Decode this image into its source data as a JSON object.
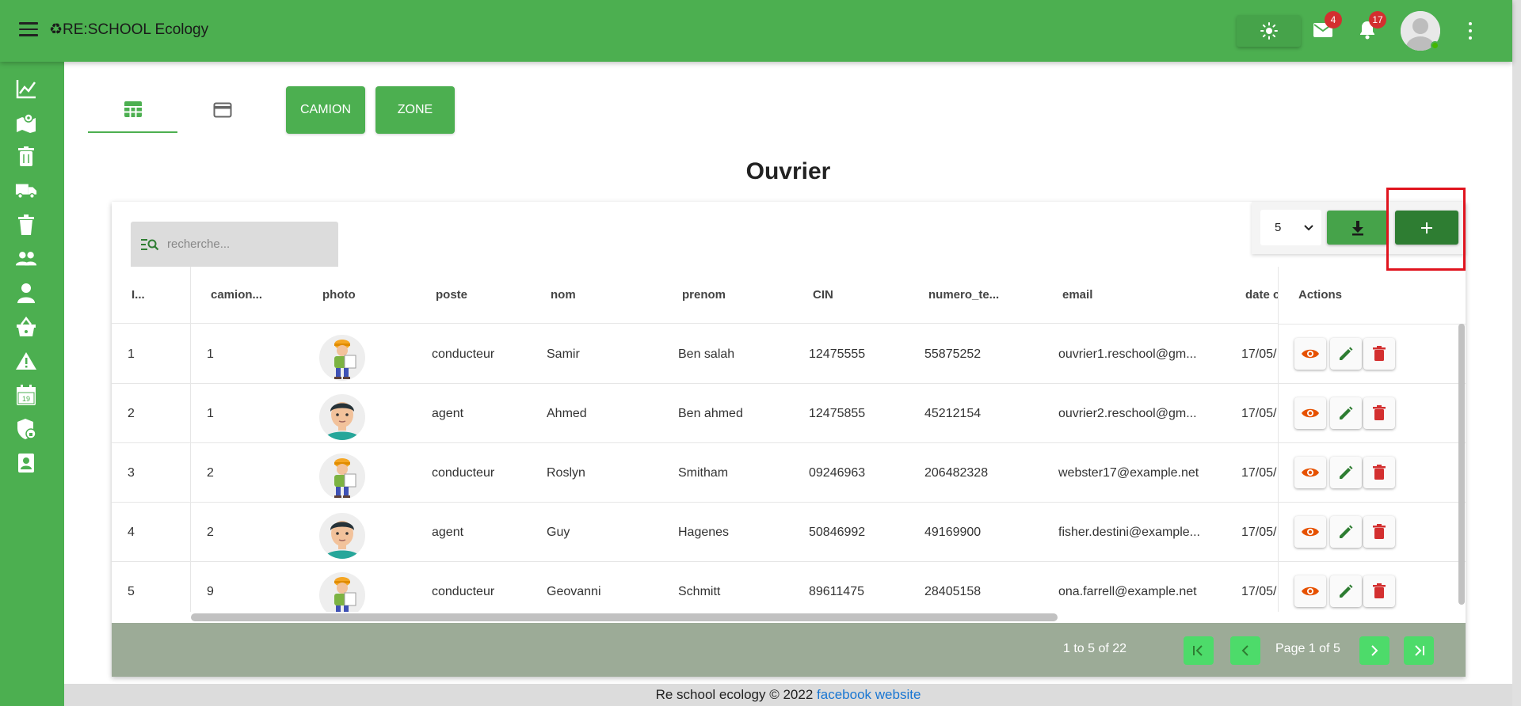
{
  "header": {
    "title": "♻RE:SCHOOL Ecology",
    "mail_count": "4",
    "notif_count": "17",
    "icons": [
      "menu-icon",
      "sun-icon",
      "mail-icon",
      "bell-icon",
      "avatar",
      "more-vert-icon"
    ]
  },
  "sidebar": {
    "icons": [
      "chart-icon",
      "map-icon",
      "trash-icon",
      "truck-icon",
      "bin-icon",
      "group-icon",
      "person-icon",
      "basket-icon",
      "warning-icon",
      "calendar-icon",
      "security-icon",
      "contact-icon"
    ],
    "calendar_day": "19"
  },
  "view_tabs": [
    "table-view-icon",
    "card-view-icon"
  ],
  "buttons": {
    "camion": "CAMION",
    "zone": "ZONE"
  },
  "page_title": "Ouvrier",
  "search": {
    "placeholder": "recherche..."
  },
  "per_page": "5",
  "table": {
    "headers": [
      "I...",
      "camion...",
      "photo",
      "poste",
      "nom",
      "prenom",
      "CIN",
      "numero_te...",
      "email",
      "date c",
      "Actions"
    ],
    "rows": [
      {
        "id": "1",
        "camion": "1",
        "photo": "worker",
        "poste": "conducteur",
        "nom": "Samir",
        "prenom": "Ben salah",
        "cin": "12475555",
        "tel": "55875252",
        "email": "ouvrier1.reschool@gm...",
        "date": "17/05/"
      },
      {
        "id": "2",
        "camion": "1",
        "photo": "agent",
        "poste": "agent",
        "nom": "Ahmed",
        "prenom": "Ben ahmed",
        "cin": "12475855",
        "tel": "45212154",
        "email": "ouvrier2.reschool@gm...",
        "date": "17/05/"
      },
      {
        "id": "3",
        "camion": "2",
        "photo": "worker",
        "poste": "conducteur",
        "nom": "Roslyn",
        "prenom": "Smitham",
        "cin": "09246963",
        "tel": "206482328",
        "email": "webster17@example.net",
        "date": "17/05/"
      },
      {
        "id": "4",
        "camion": "2",
        "photo": "agent",
        "poste": "agent",
        "nom": "Guy",
        "prenom": "Hagenes",
        "cin": "50846992",
        "tel": "49169900",
        "email": "fisher.destini@example...",
        "date": "17/05/"
      },
      {
        "id": "5",
        "camion": "9",
        "photo": "worker",
        "poste": "conducteur",
        "nom": "Geovanni",
        "prenom": "Schmitt",
        "cin": "89611475",
        "tel": "28405158",
        "email": "ona.farrell@example.net",
        "date": "17/05/"
      }
    ]
  },
  "pagination": {
    "range": "1 to 5 of 22",
    "page": "Page 1 of 5"
  },
  "footer": {
    "text": "Re school ecology © 2022 ",
    "link1": "facebook",
    "link2": "website"
  },
  "colors": {
    "primary": "#4caf50",
    "dark": "#2e7d32",
    "view": "#e65100",
    "edit": "#2e7d32",
    "delete": "#d32f2f",
    "highlight": "#e0141e"
  }
}
